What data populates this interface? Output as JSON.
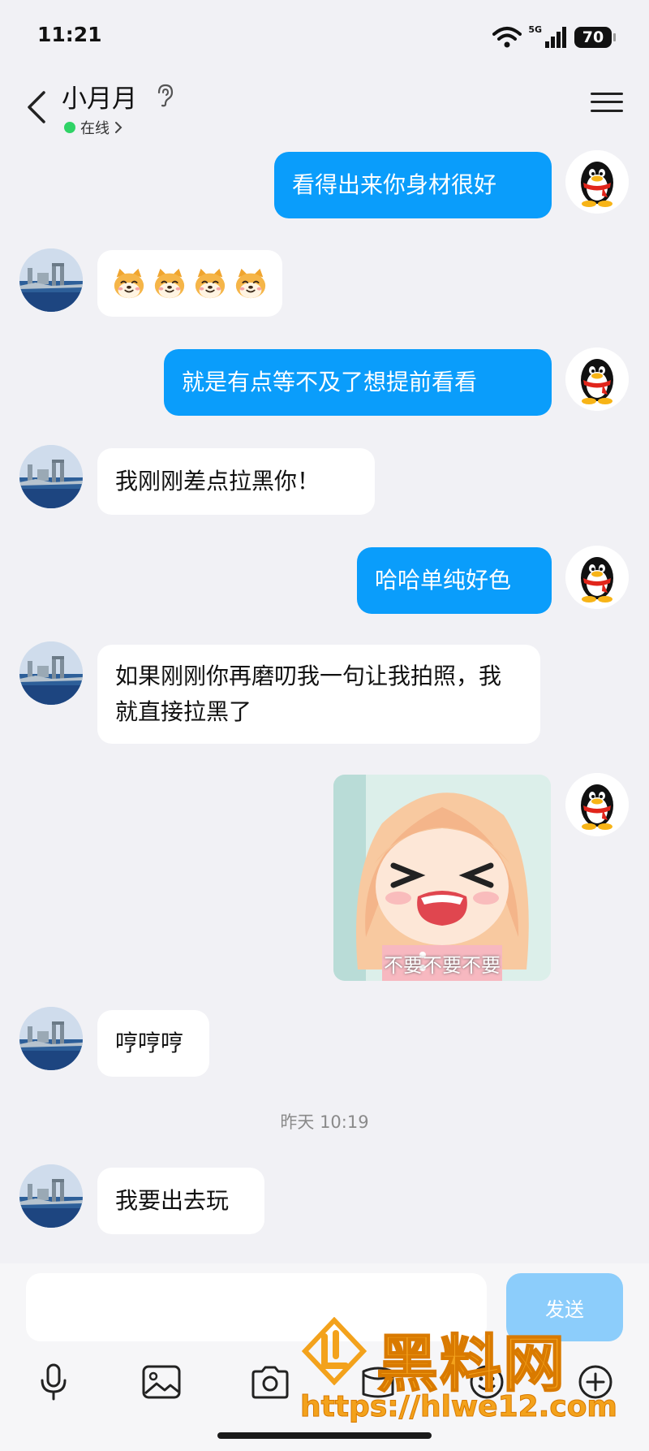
{
  "status_bar": {
    "time": "11:21",
    "network": "5G",
    "battery": "70"
  },
  "header": {
    "contact_name": "小月月",
    "online_status": "在线",
    "online_color": "#2fd366"
  },
  "messages": [
    {
      "direction": "out",
      "text": "看得出来你身材很好"
    },
    {
      "direction": "in",
      "type": "emoji",
      "emoji_count": 4,
      "emoji": "shiba-face-emoji"
    },
    {
      "direction": "out",
      "text": "就是有点等不及了想提前看看"
    },
    {
      "direction": "in",
      "text": "我刚刚差点拉黑你！"
    },
    {
      "direction": "out",
      "text": "哈哈单纯好色"
    },
    {
      "direction": "in",
      "text": "如果刚刚你再磨叨我一句让我拍照，我就直接拉黑了"
    },
    {
      "direction": "out",
      "type": "image",
      "caption": "不要不要不要"
    },
    {
      "direction": "in",
      "text": "哼哼哼"
    },
    {
      "direction": "in",
      "text": "我要出去玩"
    }
  ],
  "timestamp": "昨天 10:19",
  "input": {
    "placeholder": "",
    "send_label": "发送"
  },
  "toolbar": [
    "microphone-icon",
    "image-icon",
    "camera-icon",
    "red-packet-icon",
    "emoji-icon",
    "plus-icon"
  ],
  "watermark": {
    "title": "黑料网",
    "url": "https://hlwe12.com"
  },
  "colors": {
    "outgoing_bubble": "#0a9dfb",
    "incoming_bubble": "#ffffff",
    "background": "#f1f1f5",
    "send_button": "#8ccdfb"
  }
}
